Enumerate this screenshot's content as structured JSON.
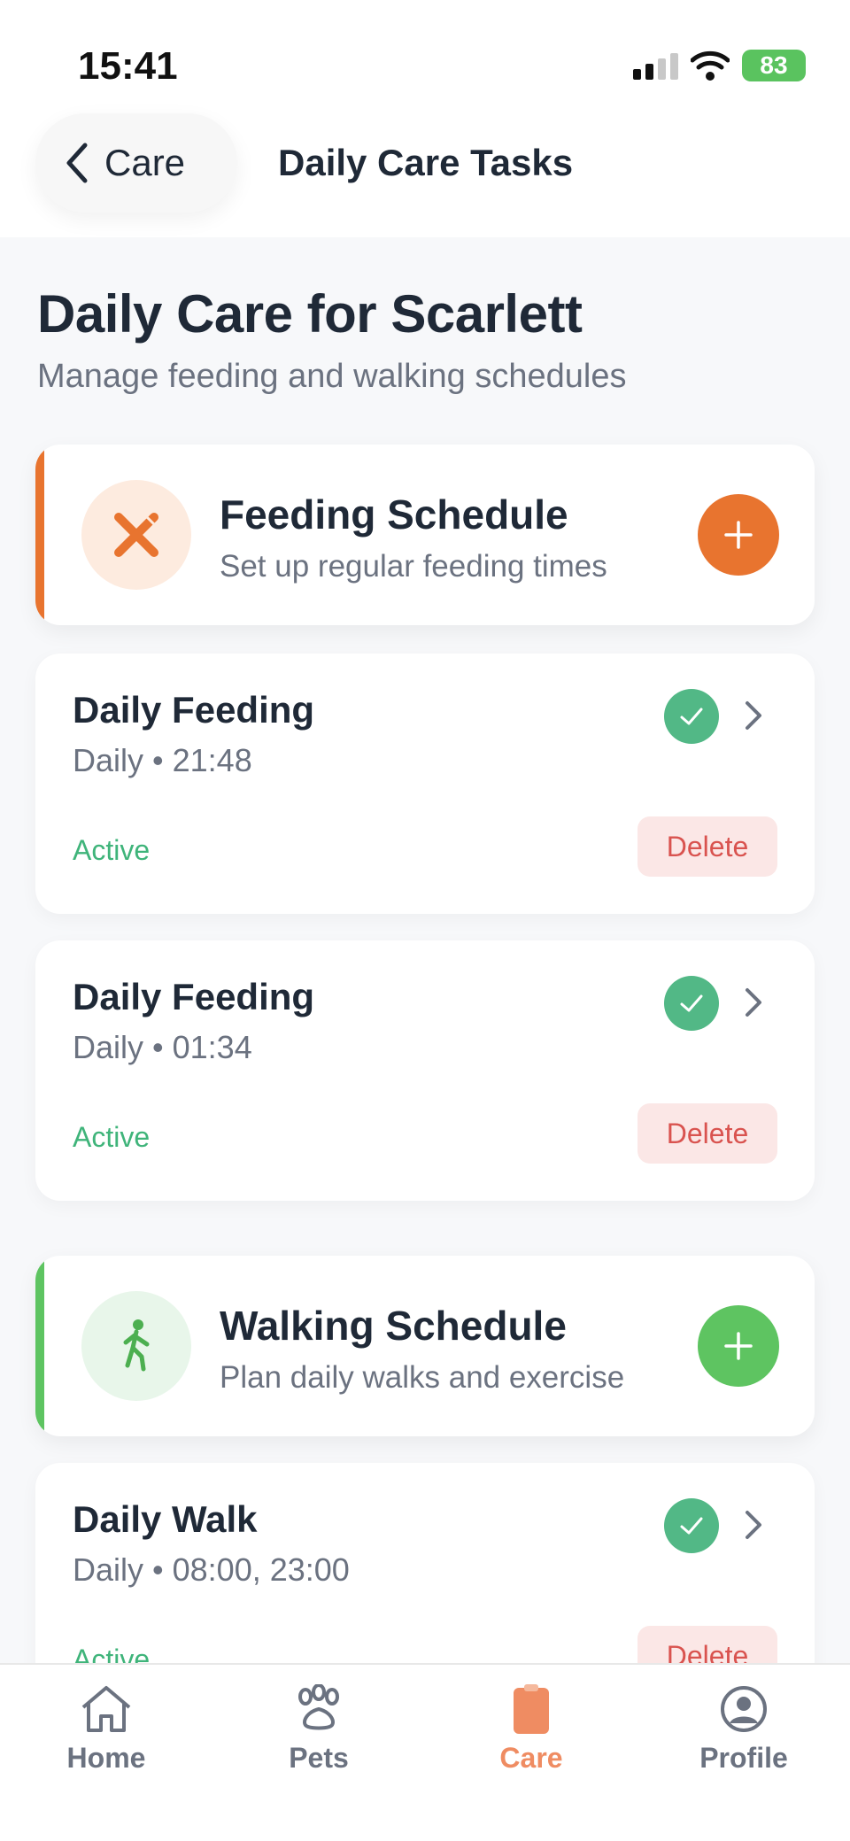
{
  "status_bar": {
    "time": "15:41",
    "battery": "83"
  },
  "nav": {
    "back_label": "Care",
    "title": "Daily Care Tasks"
  },
  "page": {
    "title": "Daily Care for Scarlett",
    "subtitle": "Manage feeding and walking schedules"
  },
  "feeding_section": {
    "title": "Feeding Schedule",
    "description": "Set up regular feeding times",
    "icon": "fork-knife-icon",
    "accent_color": "#e8742f",
    "icon_bg": "#fdebdf"
  },
  "feeding_tasks": [
    {
      "title": "Daily Feeding",
      "meta": "Daily • 21:48",
      "status": "Active",
      "delete_label": "Delete"
    },
    {
      "title": "Daily Feeding",
      "meta": "Daily • 01:34",
      "status": "Active",
      "delete_label": "Delete"
    }
  ],
  "walking_section": {
    "title": "Walking Schedule",
    "description": "Plan daily walks and exercise",
    "icon": "walking-person-icon",
    "accent_color": "#5ec461",
    "icon_bg": "#e8f6ea"
  },
  "walking_tasks": [
    {
      "title": "Daily Walk",
      "meta": "Daily • 08:00, 23:00",
      "status": "Active",
      "delete_label": "Delete"
    }
  ],
  "tab_bar": {
    "items": [
      {
        "label": "Home",
        "icon": "home-icon"
      },
      {
        "label": "Pets",
        "icon": "paw-icon"
      },
      {
        "label": "Care",
        "icon": "clipboard-icon",
        "active": true
      },
      {
        "label": "Profile",
        "icon": "profile-icon"
      }
    ],
    "active_color": "#ef8c62"
  }
}
